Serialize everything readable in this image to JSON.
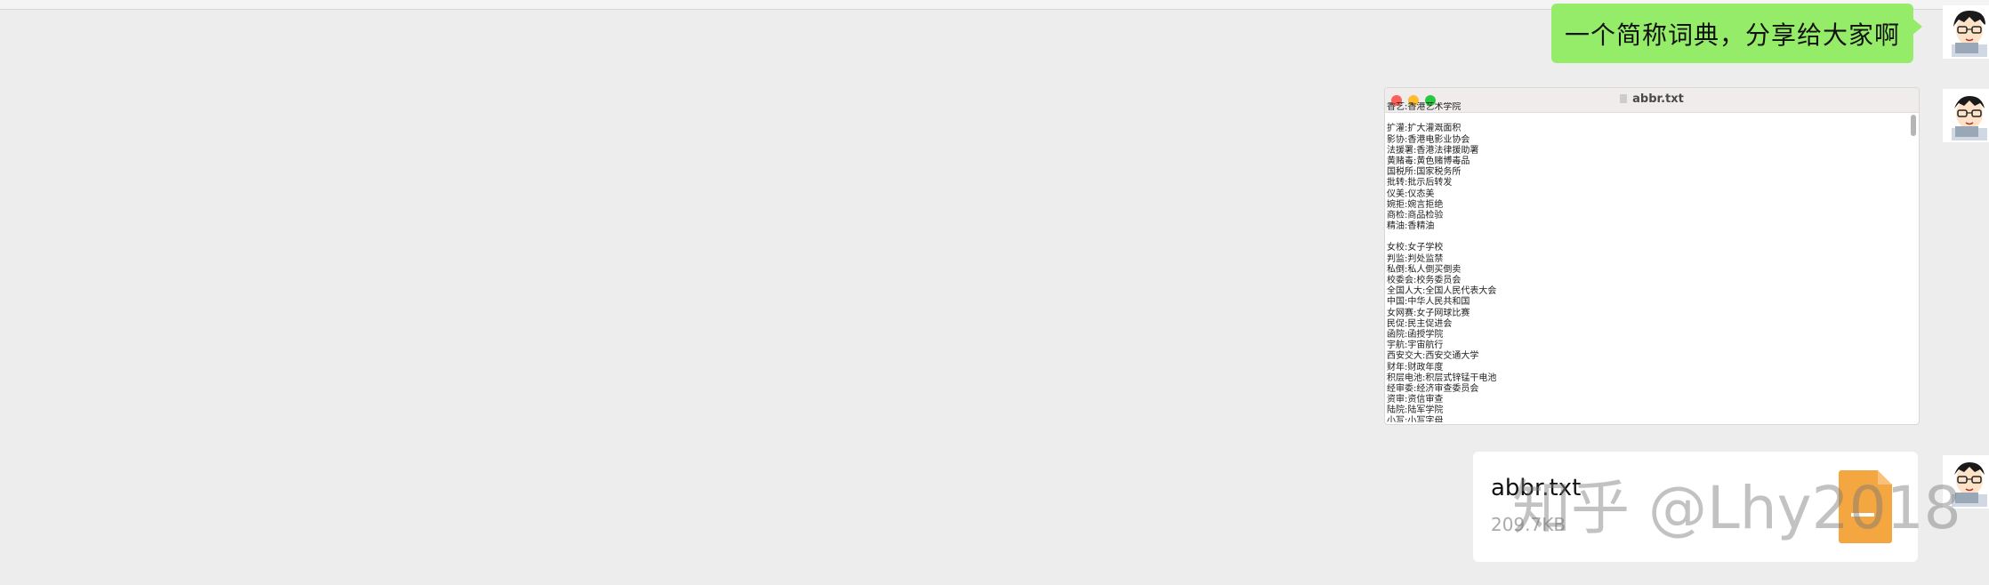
{
  "message_text": "一个简称词典，分享给大家啊",
  "screenshot": {
    "title": "abbr.txt",
    "lines": [
      "香艺:香港艺术学院",
      "",
      "扩灌:扩大灌溉面积",
      "影协:香港电影业协会",
      "法援署:香港法律援助署",
      "黄赌毒:黄色赌博毒品",
      "国税所:国家税务所",
      "批转:批示后转发",
      "仪美:仪态美",
      "婉拒:婉言拒绝",
      "商检:商品检验",
      "精油:香精油",
      "",
      "女校:女子学校",
      "判监:判处监禁",
      "私倒:私人倒买倒卖",
      "校委会:校务委员会",
      "全国人大:全国人民代表大会",
      "中国:中华人民共和国",
      "女网赛:女子网球比赛",
      "民促:民主促进会",
      "函院:函授学院",
      "宇航:宇宙航行",
      "西安交大:西安交通大学",
      "财年:财政年度",
      "积层电池:积层式锌锰干电池",
      "经审委:经济审查委员会",
      "资审:资信审查",
      "陆院:陆军学院",
      "小写:小写字母"
    ]
  },
  "file": {
    "name": "abbr.txt",
    "size": "209.7KB"
  },
  "watermark": "知乎 @Lhy2018",
  "colors": {
    "bubble": "#95ec69",
    "background": "#ededed",
    "file_icon": "#f4a640"
  },
  "icons": [
    "avatar",
    "file-doc-icon",
    "traffic-light-close",
    "traffic-light-minimize",
    "traffic-light-zoom"
  ]
}
